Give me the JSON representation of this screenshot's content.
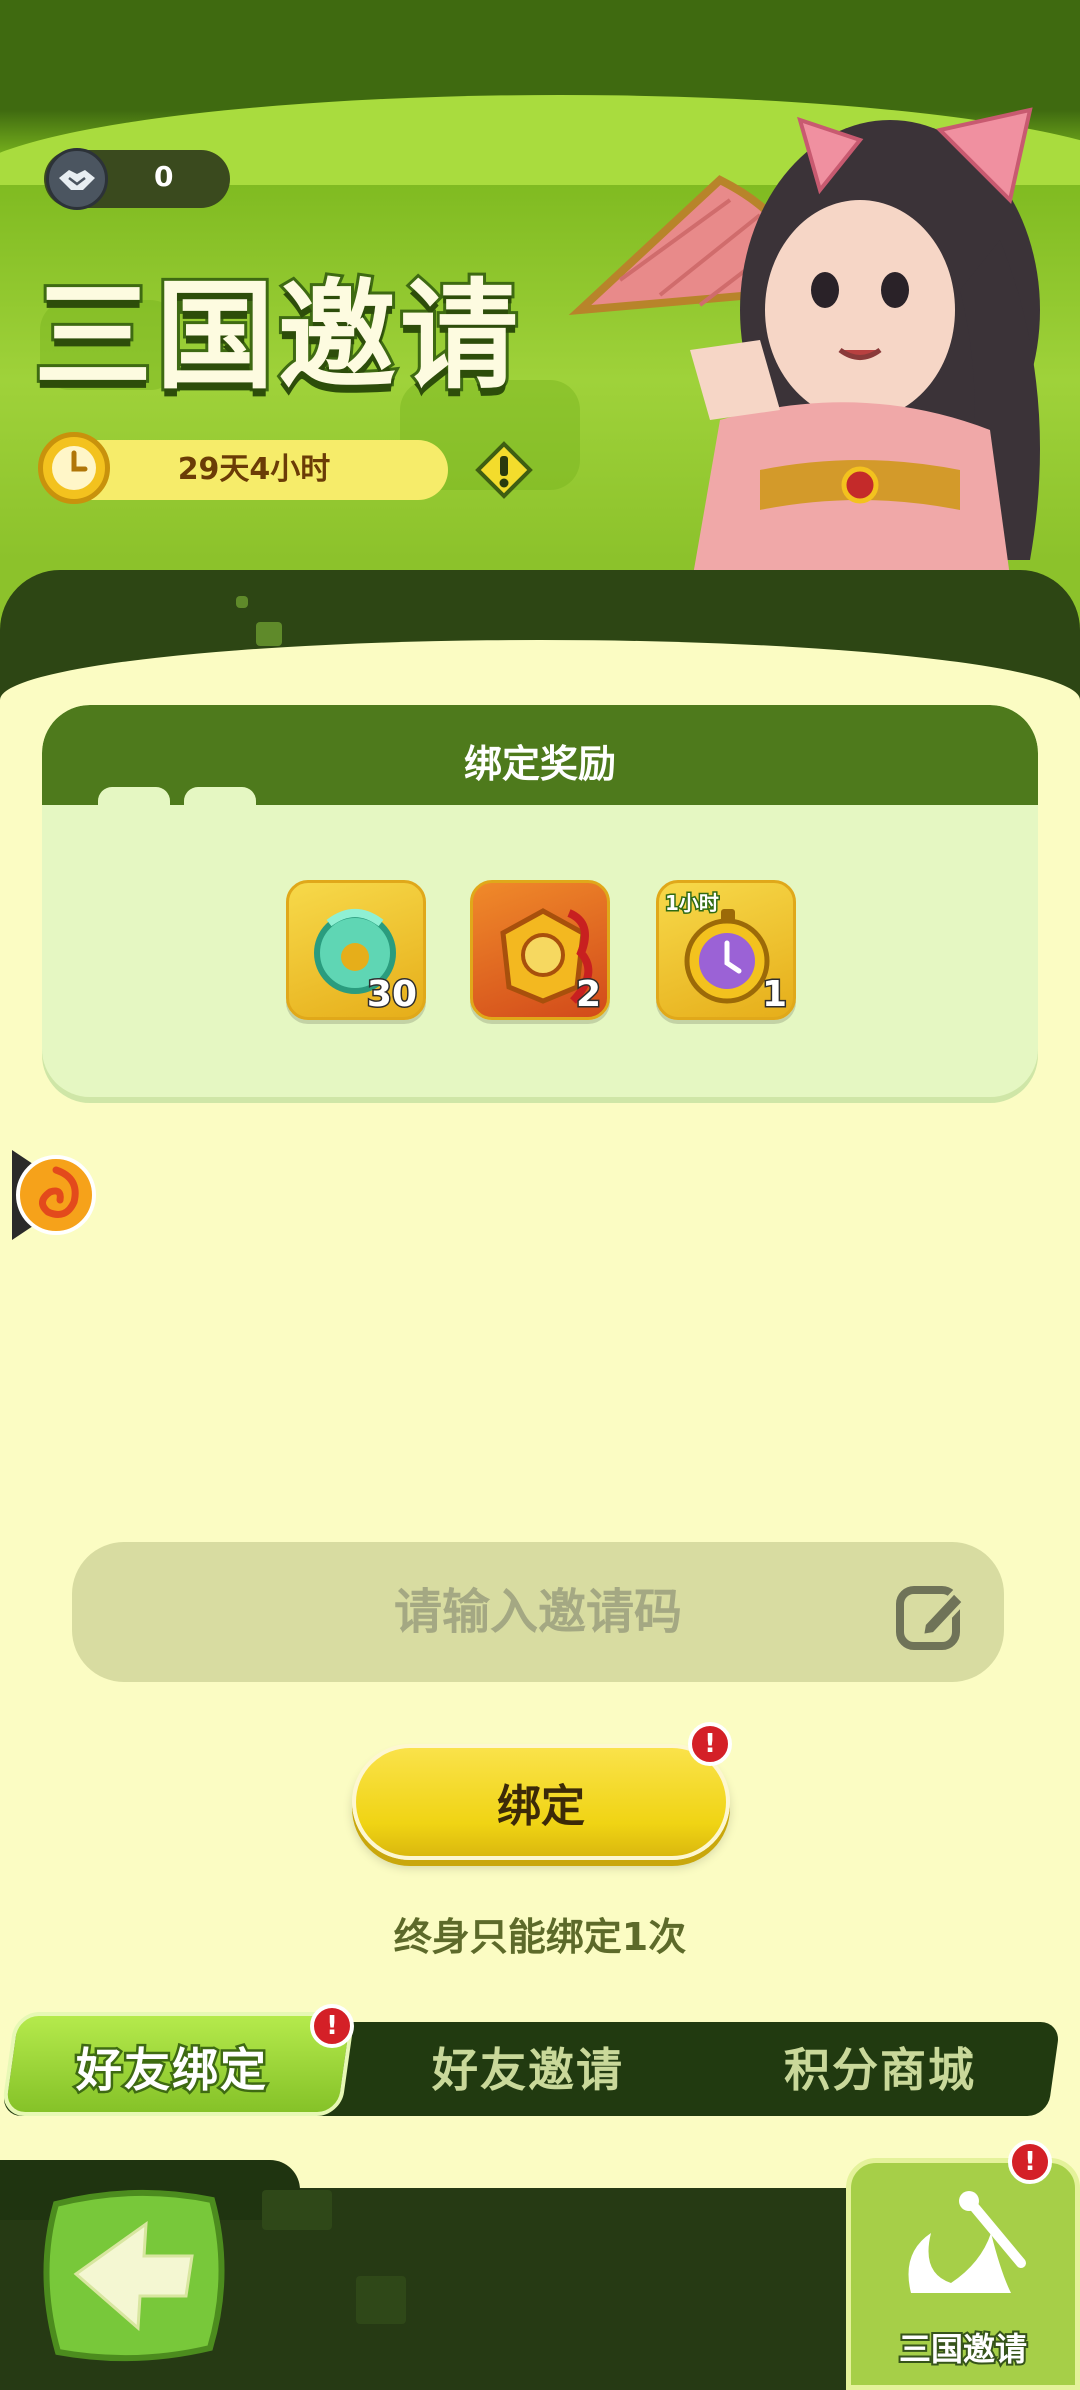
{
  "header": {
    "score": "0",
    "title": "三国邀请",
    "timer": "29天4小时"
  },
  "rewards": {
    "title": "绑定奖励",
    "items": [
      {
        "icon": "jade-ring-icon",
        "count": "30"
      },
      {
        "icon": "seal-scroll-icon",
        "count": "2"
      },
      {
        "icon": "stopwatch-icon",
        "badge": "1小时",
        "count": "1"
      }
    ]
  },
  "bind": {
    "input_placeholder": "请输入邀请码",
    "button_label": "绑定",
    "alert": "!",
    "hint": "终身只能绑定1次"
  },
  "tabs": [
    {
      "label": "好友绑定",
      "active": true,
      "alert": "!"
    },
    {
      "label": "好友邀请",
      "active": false
    },
    {
      "label": "积分商城",
      "active": false
    }
  ],
  "bottom": {
    "feature_label": "三国邀请",
    "feature_alert": "!"
  },
  "colors": {
    "header_green": "#7cb81e",
    "panel_dark": "#2d4614",
    "background": "#fbfcc3",
    "button_yellow": "#f0d414",
    "alert_red": "#d42027"
  }
}
